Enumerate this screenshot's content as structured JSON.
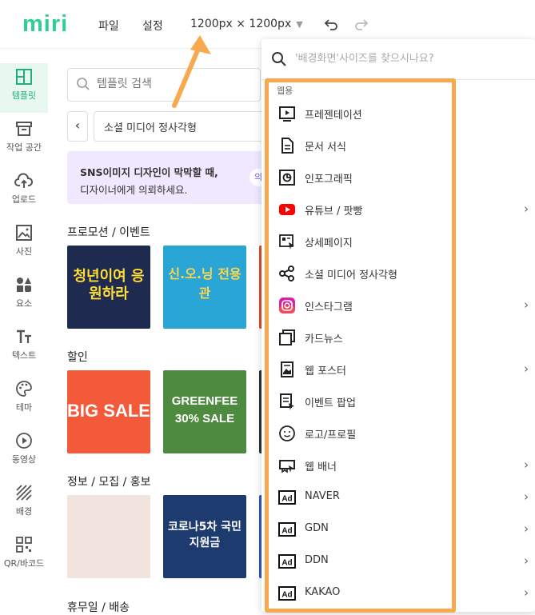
{
  "topbar": {
    "logo": "miri",
    "menu_file": "파일",
    "menu_settings": "설정",
    "canvas_size": "1200px × 1200px"
  },
  "sidebar": {
    "items": [
      {
        "label": "템플릿",
        "icon": "template-icon"
      },
      {
        "label": "작업 공간",
        "icon": "archive-icon"
      },
      {
        "label": "업로드",
        "icon": "cloud-upload-icon"
      },
      {
        "label": "사진",
        "icon": "image-icon"
      },
      {
        "label": "요소",
        "icon": "shapes-icon"
      },
      {
        "label": "텍스트",
        "icon": "text-icon"
      },
      {
        "label": "테마",
        "icon": "palette-icon"
      },
      {
        "label": "동영상",
        "icon": "play-circle-icon"
      },
      {
        "label": "배경",
        "icon": "pattern-icon"
      },
      {
        "label": "QR/바코드",
        "icon": "qr-icon"
      }
    ]
  },
  "panel": {
    "search_placeholder": "템플릿 검색",
    "category": "소셜 미디어 정사각형",
    "banner_line1": "SNS이미지 디자인이 막막할 때,",
    "banner_line2": "디자이너에게 의뢰하세요.",
    "banner_pill": "의",
    "sections": [
      {
        "title": "프로모션 / 이벤트",
        "thumbs": [
          {
            "text": "청년이여 응원하라",
            "bg": "#1e2a4f",
            "fg": "#ffdd33"
          },
          {
            "text": "신.오.닝 전용관",
            "bg": "#2aa6d6",
            "fg": "#ffd54a"
          }
        ]
      },
      {
        "title": "할인",
        "thumbs": [
          {
            "text": "BIG SALE",
            "bg": "#f25a3a",
            "fg": "#ffffff"
          },
          {
            "text": "GREENFEE 30% SALE",
            "bg": "#4e8a3f",
            "fg": "#ffffff"
          }
        ]
      },
      {
        "title": "정보 / 모집 / 홍보",
        "thumbs": [
          {
            "text": "",
            "bg": "#f1e4df",
            "fg": "#c79b8e"
          },
          {
            "text": "코로나5차 국민지원금",
            "bg": "#1d3b6e",
            "fg": "#ffffff"
          }
        ]
      },
      {
        "title": "휴무일 / 배송",
        "thumbs": []
      }
    ]
  },
  "dropdown": {
    "search_placeholder": "'배경화면'사이즈를 찾으시나요?",
    "group_label": "웹용",
    "items": [
      {
        "label": "프레젠테이션",
        "icon": "presentation-icon",
        "submenu": false
      },
      {
        "label": "문서 서식",
        "icon": "document-icon",
        "submenu": false
      },
      {
        "label": "인포그래픽",
        "icon": "infographic-icon",
        "submenu": false
      },
      {
        "label": "유튜브 / 팟빵",
        "icon": "youtube-icon",
        "submenu": true
      },
      {
        "label": "상세페이지",
        "icon": "detail-page-icon",
        "submenu": false
      },
      {
        "label": "소셜 미디어 정사각형",
        "icon": "share-icon",
        "submenu": false
      },
      {
        "label": "인스타그램",
        "icon": "instagram-icon",
        "submenu": true
      },
      {
        "label": "카드뉴스",
        "icon": "card-news-icon",
        "submenu": false
      },
      {
        "label": "웹 포스터",
        "icon": "poster-icon",
        "submenu": true
      },
      {
        "label": "이벤트 팝업",
        "icon": "popup-icon",
        "submenu": false
      },
      {
        "label": "로고/프로필",
        "icon": "logo-profile-icon",
        "submenu": false
      },
      {
        "label": "웹 배너",
        "icon": "banner-icon",
        "submenu": true
      },
      {
        "label": "NAVER",
        "icon": "ad-icon",
        "submenu": true
      },
      {
        "label": "GDN",
        "icon": "ad-icon",
        "submenu": true
      },
      {
        "label": "DDN",
        "icon": "ad-icon",
        "submenu": true
      },
      {
        "label": "KAKAO",
        "icon": "ad-icon",
        "submenu": true
      }
    ]
  },
  "colors": {
    "brand": "#2fcf93",
    "highlight": "#f8a94f",
    "banner_bg": "#efe8ff"
  }
}
